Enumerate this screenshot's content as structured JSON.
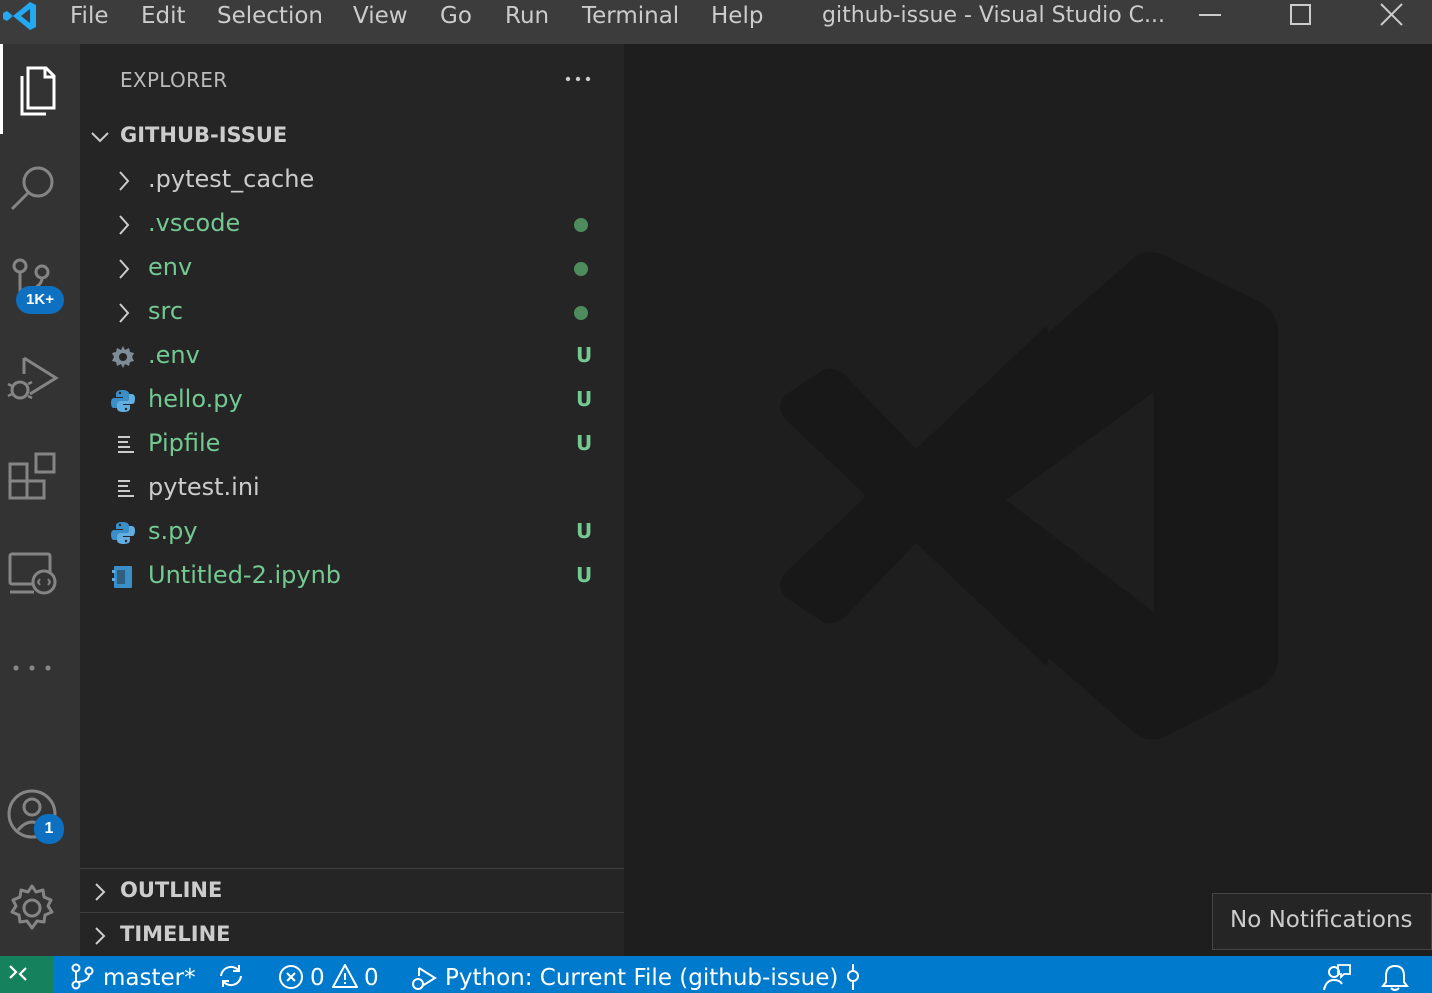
{
  "titlebar": {
    "menu": [
      "File",
      "Edit",
      "Selection",
      "View",
      "Go",
      "Run",
      "Terminal",
      "Help"
    ],
    "window_title": "github-issue - Visual Studio C...",
    "icons": [
      "vscode-logo-icon",
      "minimize-icon",
      "maximize-icon",
      "close-icon"
    ]
  },
  "activitybar": {
    "items": [
      {
        "name": "explorer",
        "icon": "files-icon"
      },
      {
        "name": "search",
        "icon": "search-icon"
      },
      {
        "name": "source-control",
        "icon": "source-control-icon",
        "badge": "1K+"
      },
      {
        "name": "run-and-debug",
        "icon": "debug-icon"
      },
      {
        "name": "extensions",
        "icon": "extensions-icon"
      },
      {
        "name": "remote-explorer",
        "icon": "remote-explorer-icon"
      },
      {
        "name": "more",
        "icon": "ellipsis-icon"
      }
    ],
    "accounts_badge": "1"
  },
  "sidebar": {
    "title": "EXPLORER",
    "root_folder": "GITHUB-ISSUE",
    "tree": [
      {
        "label": ".pytest_cache",
        "type": "folder",
        "color": "#cccccc",
        "status": ""
      },
      {
        "label": ".vscode",
        "type": "folder",
        "color": "#73c991",
        "status": "dot"
      },
      {
        "label": "env",
        "type": "folder",
        "color": "#73c991",
        "status": "dot"
      },
      {
        "label": "src",
        "type": "folder",
        "color": "#73c991",
        "status": "dot"
      },
      {
        "label": ".env",
        "type": "gear",
        "color": "#73c991",
        "status": "U"
      },
      {
        "label": "hello.py",
        "type": "python",
        "color": "#73c991",
        "status": "U"
      },
      {
        "label": "Pipfile",
        "type": "lines",
        "color": "#73c991",
        "status": "U"
      },
      {
        "label": "pytest.ini",
        "type": "lines",
        "color": "#cccccc",
        "status": ""
      },
      {
        "label": "s.py",
        "type": "python",
        "color": "#73c991",
        "status": "U"
      },
      {
        "label": "Untitled-2.ipynb",
        "type": "notebook",
        "color": "#73c991",
        "status": "U"
      }
    ],
    "outline": "OUTLINE",
    "timeline": "TIMELINE"
  },
  "notification": {
    "text": "No Notifications"
  },
  "statusbar": {
    "branch": "master*",
    "errors": "0",
    "warnings": "0",
    "debug_config": "Python: Current File (github-issue)",
    "colors": {
      "background": "#007acc",
      "remote": "#16825d"
    }
  }
}
